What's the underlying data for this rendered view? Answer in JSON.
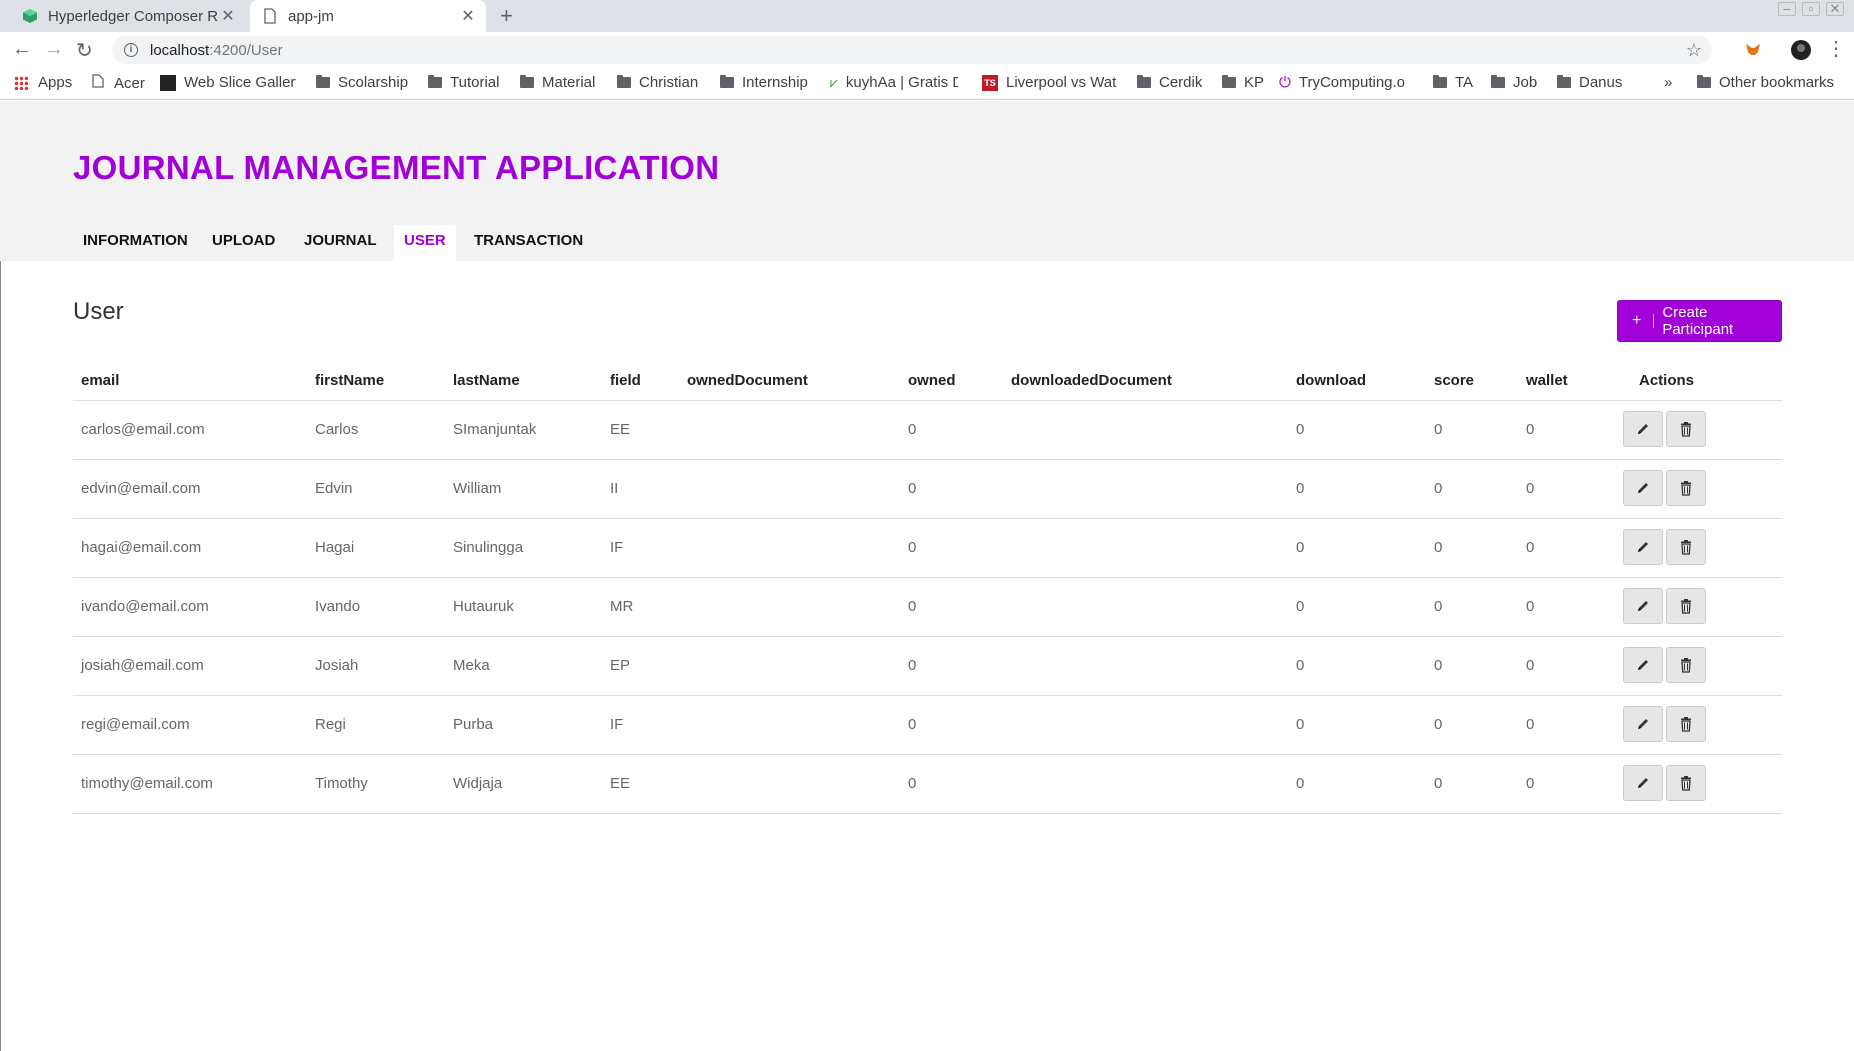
{
  "browser": {
    "tabs": [
      {
        "title": "Hyperledger Composer R",
        "active": false,
        "icon": "cube-icon"
      },
      {
        "title": "app-jm",
        "active": true,
        "icon": "page-icon"
      }
    ],
    "url_host": "localhost",
    "url_path": ":4200/User",
    "bookmarks": [
      {
        "label": "Apps",
        "icon": "apps-grid-icon"
      },
      {
        "label": "Acer",
        "icon": "page-icon"
      },
      {
        "label": "Web Slice Gallery",
        "icon": "webslice-icon"
      },
      {
        "label": "Scolarship",
        "icon": "folder-icon"
      },
      {
        "label": "Tutorial",
        "icon": "folder-icon"
      },
      {
        "label": "Material",
        "icon": "folder-icon"
      },
      {
        "label": "Christian",
        "icon": "folder-icon"
      },
      {
        "label": "Internship",
        "icon": "folder-icon"
      },
      {
        "label": "kuyhAa | Gratis D",
        "icon": "kuyhaa-icon"
      },
      {
        "label": "Liverpool vs Wat",
        "icon": "ts-icon"
      },
      {
        "label": "Cerdik",
        "icon": "folder-icon"
      },
      {
        "label": "KP",
        "icon": "folder-icon"
      },
      {
        "label": "TryComputing.o",
        "icon": "power-icon"
      },
      {
        "label": "TA",
        "icon": "folder-icon"
      },
      {
        "label": "Job",
        "icon": "folder-icon"
      },
      {
        "label": "Danus",
        "icon": "folder-icon"
      }
    ],
    "overflow": "»",
    "other_bookmarks": "Other bookmarks"
  },
  "app": {
    "title": "JOURNAL MANAGEMENT APPLICATION",
    "nav": [
      "INFORMATION",
      "UPLOAD",
      "JOURNAL",
      "USER",
      "TRANSACTION"
    ],
    "active_nav": "USER",
    "accent": "#a100d6"
  },
  "page": {
    "title": "User",
    "create_button": "Create Participant"
  },
  "table": {
    "columns": [
      "email",
      "firstName",
      "lastName",
      "field",
      "ownedDocument",
      "owned",
      "downloadedDocument",
      "download",
      "score",
      "wallet",
      "Actions"
    ],
    "rows": [
      [
        "carlos@email.com",
        "Carlos",
        "SImanjuntak",
        "EE",
        "",
        "0",
        "",
        "0",
        "0",
        "0"
      ],
      [
        "edvin@email.com",
        "Edvin",
        "William",
        "II",
        "",
        "0",
        "",
        "0",
        "0",
        "0"
      ],
      [
        "hagai@email.com",
        "Hagai",
        "Sinulingga",
        "IF",
        "",
        "0",
        "",
        "0",
        "0",
        "0"
      ],
      [
        "ivando@email.com",
        "Ivando",
        "Hutauruk",
        "MR",
        "",
        "0",
        "",
        "0",
        "0",
        "0"
      ],
      [
        "josiah@email.com",
        "Josiah",
        "Meka",
        "EP",
        "",
        "0",
        "",
        "0",
        "0",
        "0"
      ],
      [
        "regi@email.com",
        "Regi",
        "Purba",
        "IF",
        "",
        "0",
        "",
        "0",
        "0",
        "0"
      ],
      [
        "timothy@email.com",
        "Timothy",
        "Widjaja",
        "EE",
        "",
        "0",
        "",
        "0",
        "0",
        "0"
      ]
    ]
  }
}
